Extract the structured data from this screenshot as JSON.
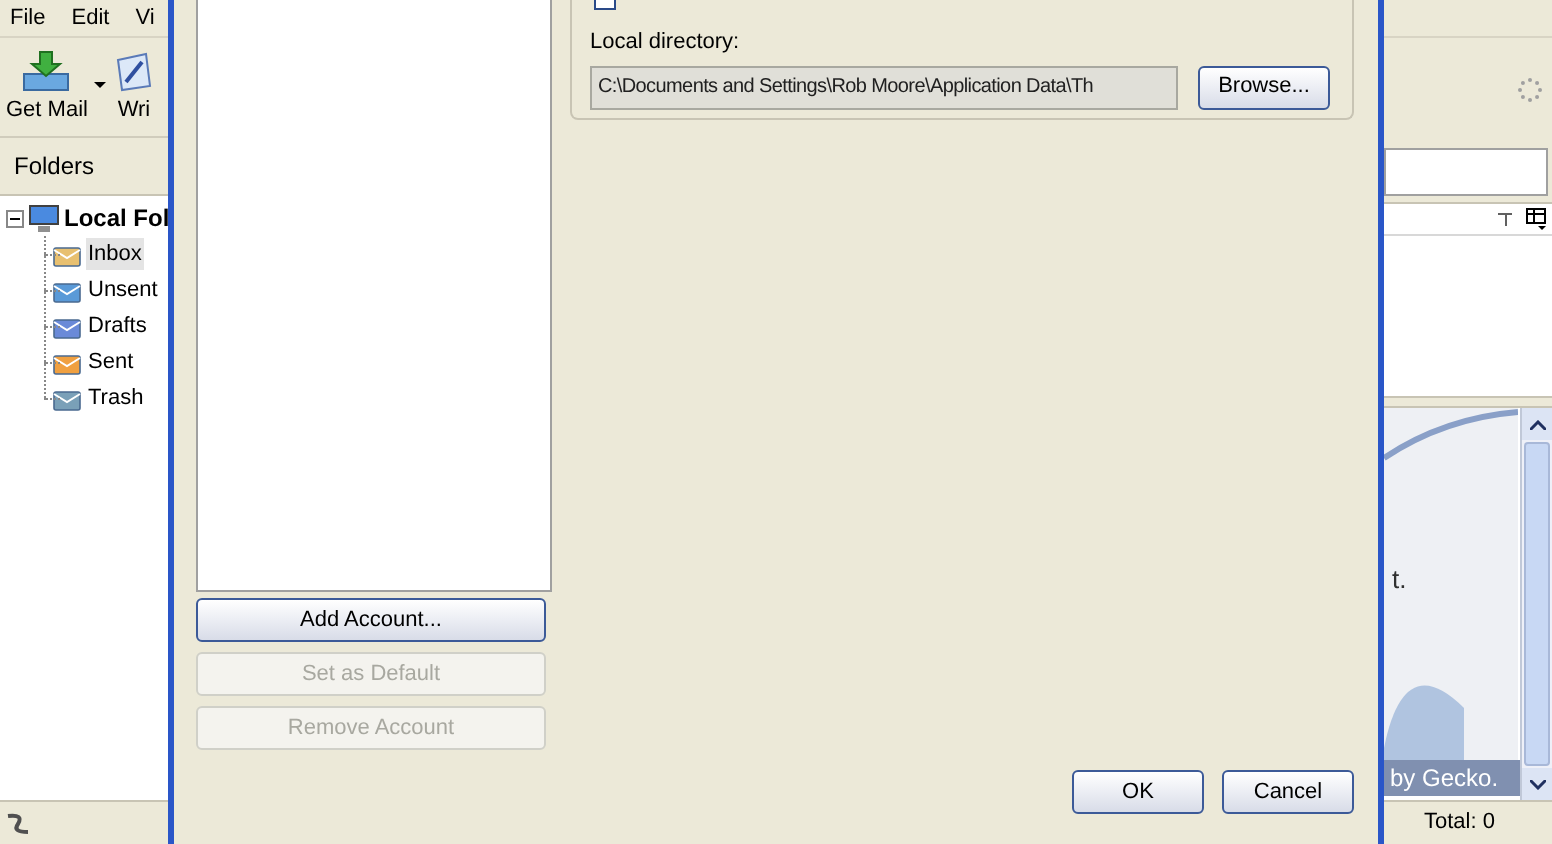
{
  "main_window": {
    "menu": [
      "File",
      "Edit",
      "Vi"
    ],
    "toolbar": [
      {
        "label": "Get Mail",
        "kind": "getmail"
      },
      {
        "label": "Wri",
        "kind": "write"
      }
    ],
    "folders_header": "Folders",
    "folder_tree": {
      "label": "Local Fol",
      "expanded": true,
      "children": [
        {
          "label": "Inbox",
          "selected": true,
          "kind": "inbox"
        },
        {
          "label": "Unsent",
          "selected": false,
          "kind": "unsent"
        },
        {
          "label": "Drafts",
          "selected": false,
          "kind": "drafts"
        },
        {
          "label": "Sent",
          "selected": false,
          "kind": "sent"
        },
        {
          "label": "Trash",
          "selected": false,
          "kind": "trash"
        }
      ]
    },
    "message_pane_text": "t.",
    "banner_text": "by Gecko.",
    "status_total": "Total: 0"
  },
  "dialog": {
    "account_buttons": [
      {
        "label": "Add Account...",
        "disabled": false
      },
      {
        "label": "Set as Default",
        "disabled": true
      },
      {
        "label": "Remove Account",
        "disabled": true
      }
    ],
    "checkbox_checked": false,
    "local_directory_label": "Local directory:",
    "local_directory_value": "C:\\Documents and Settings\\Rob Moore\\Application Data\\Th",
    "browse_button": "Browse...",
    "ok_button": "OK",
    "cancel_button": "Cancel"
  }
}
